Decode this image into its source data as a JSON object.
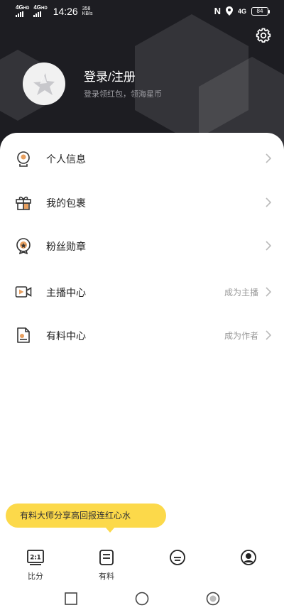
{
  "status_bar": {
    "sim1": "4G",
    "sim1_sup": "HD",
    "sim2": "4G",
    "sim2_sup": "HD",
    "time": "14:26",
    "speed_value": "358",
    "speed_unit": "KB/s",
    "network_right": "4G",
    "battery": "84"
  },
  "profile": {
    "login_title": "登录/注册",
    "login_subtitle": "登录领红包，领海星币"
  },
  "menu": {
    "items": [
      {
        "label": "个人信息",
        "hint": ""
      },
      {
        "label": "我的包裹",
        "hint": ""
      },
      {
        "label": "粉丝勋章",
        "hint": ""
      },
      {
        "label": "主播中心",
        "hint": "成为主播"
      },
      {
        "label": "有料中心",
        "hint": "成为作者"
      }
    ]
  },
  "banner": {
    "text": "有料大师分享高回报连红心水"
  },
  "tabs": [
    {
      "label": "比分",
      "icon_text": "2:1"
    },
    {
      "label": "有料",
      "icon_text": ""
    },
    {
      "label": "",
      "icon_text": ""
    },
    {
      "label": "",
      "icon_text": ""
    }
  ],
  "colors": {
    "header_bg": "#1d1d22",
    "accent_yellow": "#fcd94a",
    "icon_orange": "#e8a060"
  },
  "icons": {
    "settings": "gear-icon",
    "avatar": "star-logo-icon",
    "personal_info": "user-badge-icon",
    "package": "gift-icon",
    "fan_medal": "medal-icon",
    "anchor": "video-play-icon",
    "author": "document-icon"
  }
}
